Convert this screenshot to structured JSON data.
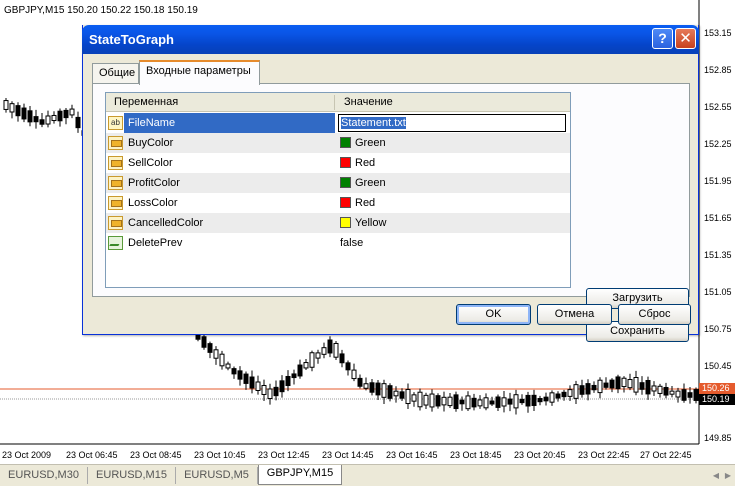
{
  "chart": {
    "symbol_header": "GBPJPY,M15  150.20 150.22 150.18 150.19",
    "price_labels": [
      "153.15",
      "152.85",
      "152.55",
      "152.25",
      "151.95",
      "151.65",
      "151.35",
      "151.05",
      "150.75",
      "150.45",
      "149.85"
    ],
    "current_price_red": "150.26",
    "current_price_black": "150.19",
    "time_labels": [
      "23 Oct 2009",
      "23 Oct 06:45",
      "23 Oct 08:45",
      "23 Oct 10:45",
      "23 Oct 12:45",
      "23 Oct 14:45",
      "23 Oct 16:45",
      "23 Oct 18:45",
      "23 Oct 20:45",
      "23 Oct 22:45",
      "27 Oct 22:45"
    ],
    "colors": {
      "price_line": "#e55b2d",
      "candle": "#000000"
    }
  },
  "chart_tabs": [
    {
      "label": "EURUSD,M30",
      "active": false
    },
    {
      "label": "EURUSD,M15",
      "active": false
    },
    {
      "label": "EURUSD,M5",
      "active": false
    },
    {
      "label": "GBPJPY,M15",
      "active": true
    }
  ],
  "dialog": {
    "title": "StateToGraph",
    "help_icon": "?",
    "close_icon": "✕",
    "tabs": {
      "general": "Общие",
      "inputs": "Входные параметры"
    },
    "table": {
      "header_variable": "Переменная",
      "header_value": "Значение",
      "rows": [
        {
          "name": "FileName",
          "value": "Statement.txt",
          "type": "string",
          "color": ""
        },
        {
          "name": "BuyColor",
          "value": "Green",
          "type": "color",
          "color": "#008000"
        },
        {
          "name": "SellColor",
          "value": "Red",
          "type": "color",
          "color": "#ff0000"
        },
        {
          "name": "ProfitColor",
          "value": "Green",
          "type": "color",
          "color": "#008000"
        },
        {
          "name": "LossColor",
          "value": "Red",
          "type": "color",
          "color": "#ff0000"
        },
        {
          "name": "CancelledColor",
          "value": "Yellow",
          "type": "color",
          "color": "#ffff00"
        },
        {
          "name": "DeletePrev",
          "value": "false",
          "type": "bool",
          "color": ""
        }
      ]
    },
    "load_label": "Загрузить",
    "save_label": "Сохранить",
    "ok_label": "OK",
    "cancel_label": "Отмена",
    "reset_label": "Сброс"
  }
}
